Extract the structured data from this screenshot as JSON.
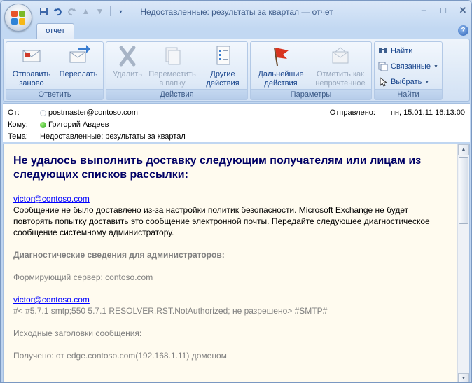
{
  "window": {
    "title": "Недоставленные: результаты за квартал — отчет"
  },
  "tabs": [
    {
      "label": "отчет"
    }
  ],
  "ribbon": {
    "groups": [
      {
        "label": "Ответить",
        "buttons": [
          {
            "label": "Отправить заново"
          },
          {
            "label": "Переслать"
          }
        ]
      },
      {
        "label": "Действия",
        "buttons": [
          {
            "label": "Удалить"
          },
          {
            "label": "Переместить в папку"
          },
          {
            "label": "Другие действия"
          }
        ]
      },
      {
        "label": "Параметры",
        "buttons": [
          {
            "label": "Дальнейшие действия"
          },
          {
            "label": "Отметить как непрочтенное"
          }
        ]
      },
      {
        "label": "Найти",
        "buttons": [
          {
            "label": "Найти"
          },
          {
            "label": "Связанные"
          },
          {
            "label": "Выбрать"
          }
        ]
      }
    ]
  },
  "header": {
    "from_label": "От:",
    "from_value": "postmaster@contoso.com",
    "to_label": "Кому:",
    "to_value": "Григорий Авдеев",
    "subject_label": "Тема:",
    "subject_value": "Недоставленные: результаты за квартал",
    "sent_label": "Отправлено:",
    "sent_value": "пн, 15.01.11 16:13:00"
  },
  "message": {
    "heading": "Не удалось выполнить доставку следующим получателям или лицам из следующих списков рассылки:",
    "recipient_link": "victor@contoso.com",
    "explanation": "Сообщение не было доставлено из-за настройки политик безопасности. Microsoft Exchange не будет повторять попытку доставить это сообщение электронной почты. Передайте следующее диагностическое сообщение системному администратору.",
    "diag_heading": "Диагностические сведения для администраторов:",
    "generating_server": "Формирующий сервер: contoso.com",
    "diag_link": "victor@contoso.com",
    "diag_code": "#< #5.7.1 smtp;550 5.7.1 RESOLVER.RST.NotAuthorized; не разрешено> #SMTP#",
    "original_headers": "Исходные заголовки сообщения:",
    "received": "Получено: от edge.contoso.com(192.168.1.11) доменом"
  },
  "colors": {
    "heading": "#000066",
    "link": "#0000ff",
    "message_background": "#fffbef",
    "ribbon_text": "#15428b"
  },
  "icons": [
    "office-button-icon",
    "save-icon",
    "undo-icon",
    "redo-icon",
    "up-arrow-icon",
    "down-arrow-icon",
    "help-icon",
    "resend-icon",
    "forward-icon",
    "delete-icon",
    "move-to-folder-icon",
    "other-actions-icon",
    "follow-up-flag-icon",
    "mark-unread-icon",
    "find-icon",
    "related-icon",
    "select-icon"
  ]
}
